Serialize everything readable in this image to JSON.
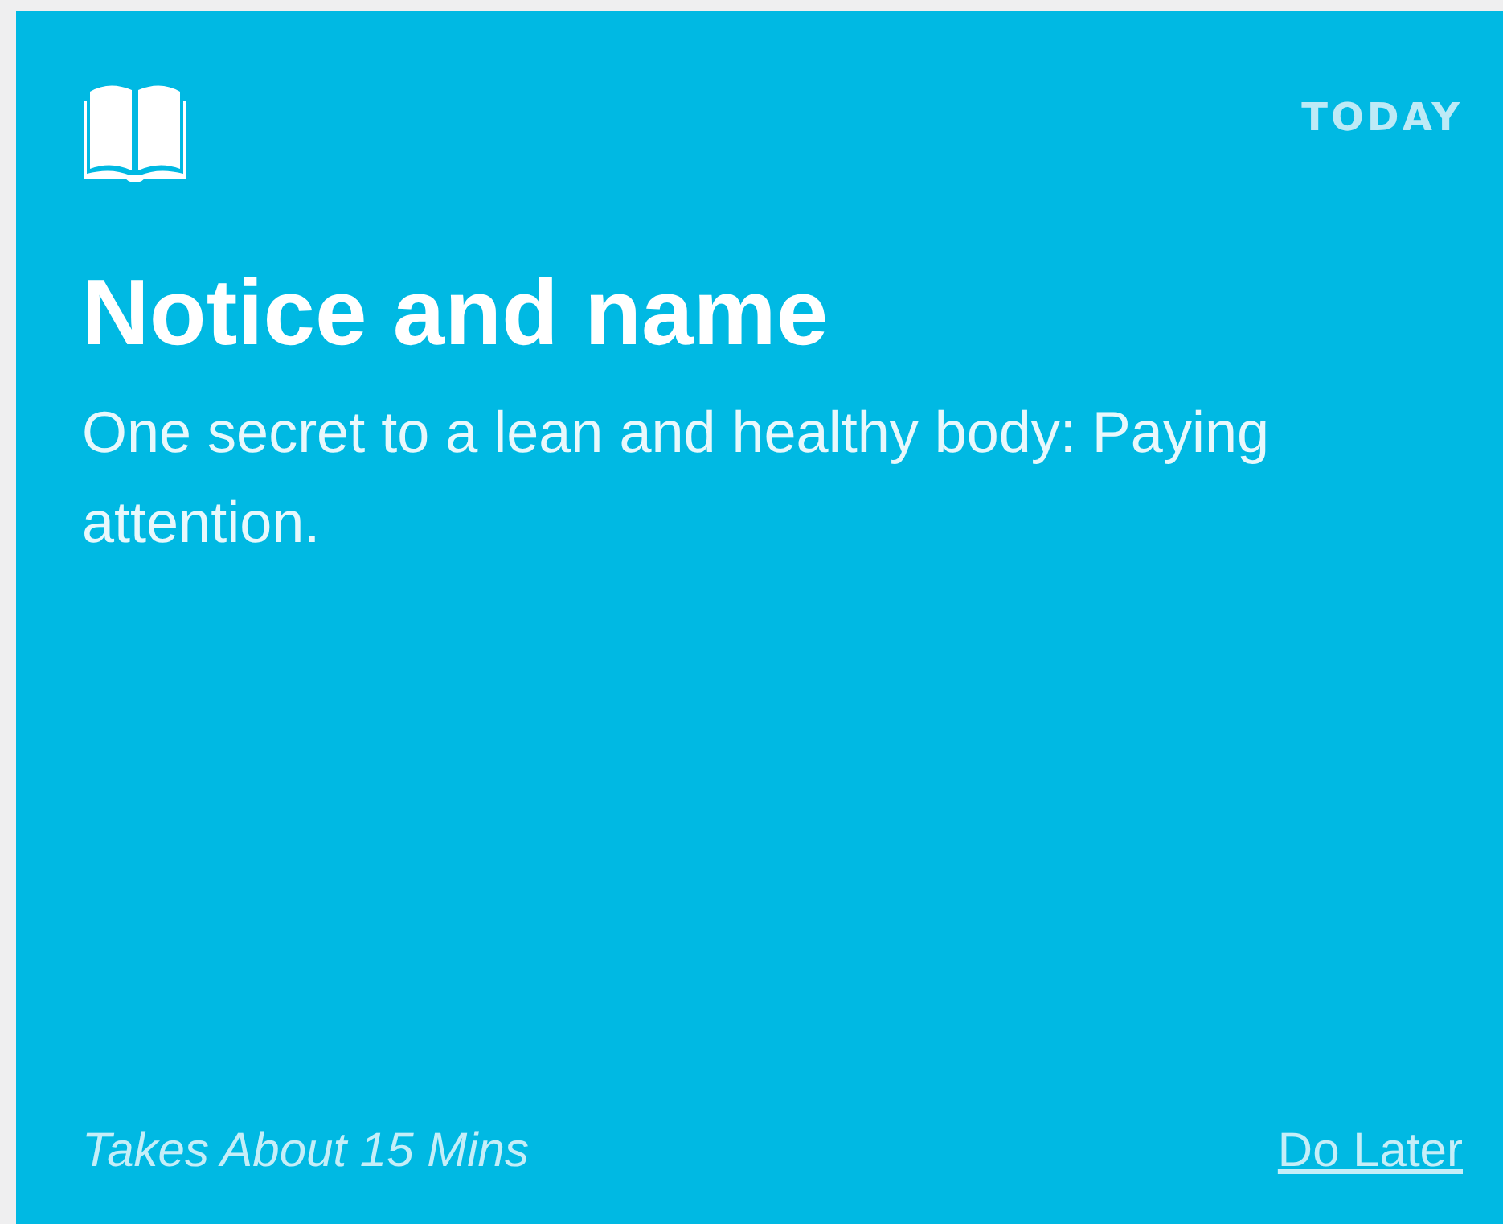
{
  "card": {
    "badge": "TODAY",
    "title": "Notice and name",
    "description": "One secret to a lean and healthy body: Paying attention.",
    "duration": "Takes About 15 Mins",
    "action": "Do Later"
  }
}
